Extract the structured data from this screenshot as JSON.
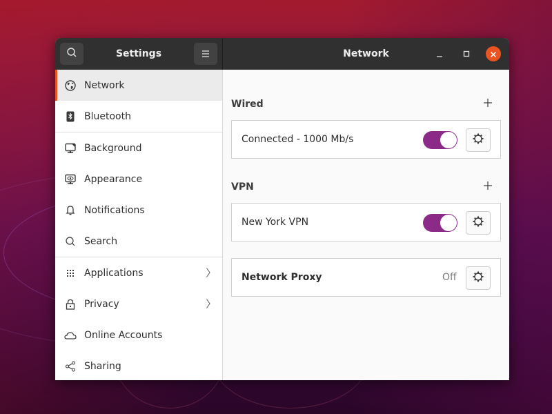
{
  "window": {
    "sidebar_title": "Settings",
    "panel_title": "Network",
    "controls": {
      "minimize": "minimize-icon",
      "maximize": "maximize-icon",
      "close": "close-icon"
    },
    "accent_color": "#e95420",
    "toggle_color": "#8c2a88"
  },
  "header": {
    "search_icon": "search-icon",
    "menu_icon": "hamburger-menu-icon"
  },
  "sidebar": {
    "items": [
      {
        "label": "Network",
        "icon": "globe-icon",
        "active": true
      },
      {
        "label": "Bluetooth",
        "icon": "bluetooth-icon"
      },
      {
        "label": "Background",
        "icon": "background-icon"
      },
      {
        "label": "Appearance",
        "icon": "appearance-icon"
      },
      {
        "label": "Notifications",
        "icon": "bell-icon"
      },
      {
        "label": "Search",
        "icon": "search-icon"
      },
      {
        "label": "Applications",
        "icon": "apps-grid-icon",
        "has_submenu": true
      },
      {
        "label": "Privacy",
        "icon": "lock-icon",
        "has_submenu": true
      },
      {
        "label": "Online Accounts",
        "icon": "cloud-icon"
      },
      {
        "label": "Sharing",
        "icon": "share-icon"
      }
    ]
  },
  "content": {
    "wired": {
      "title": "Wired",
      "connection": {
        "label": "Connected - 1000 Mb/s",
        "enabled": true
      }
    },
    "vpn": {
      "title": "VPN",
      "connection": {
        "label": "New York VPN",
        "enabled": true
      }
    },
    "proxy": {
      "label": "Network Proxy",
      "status": "Off"
    }
  }
}
